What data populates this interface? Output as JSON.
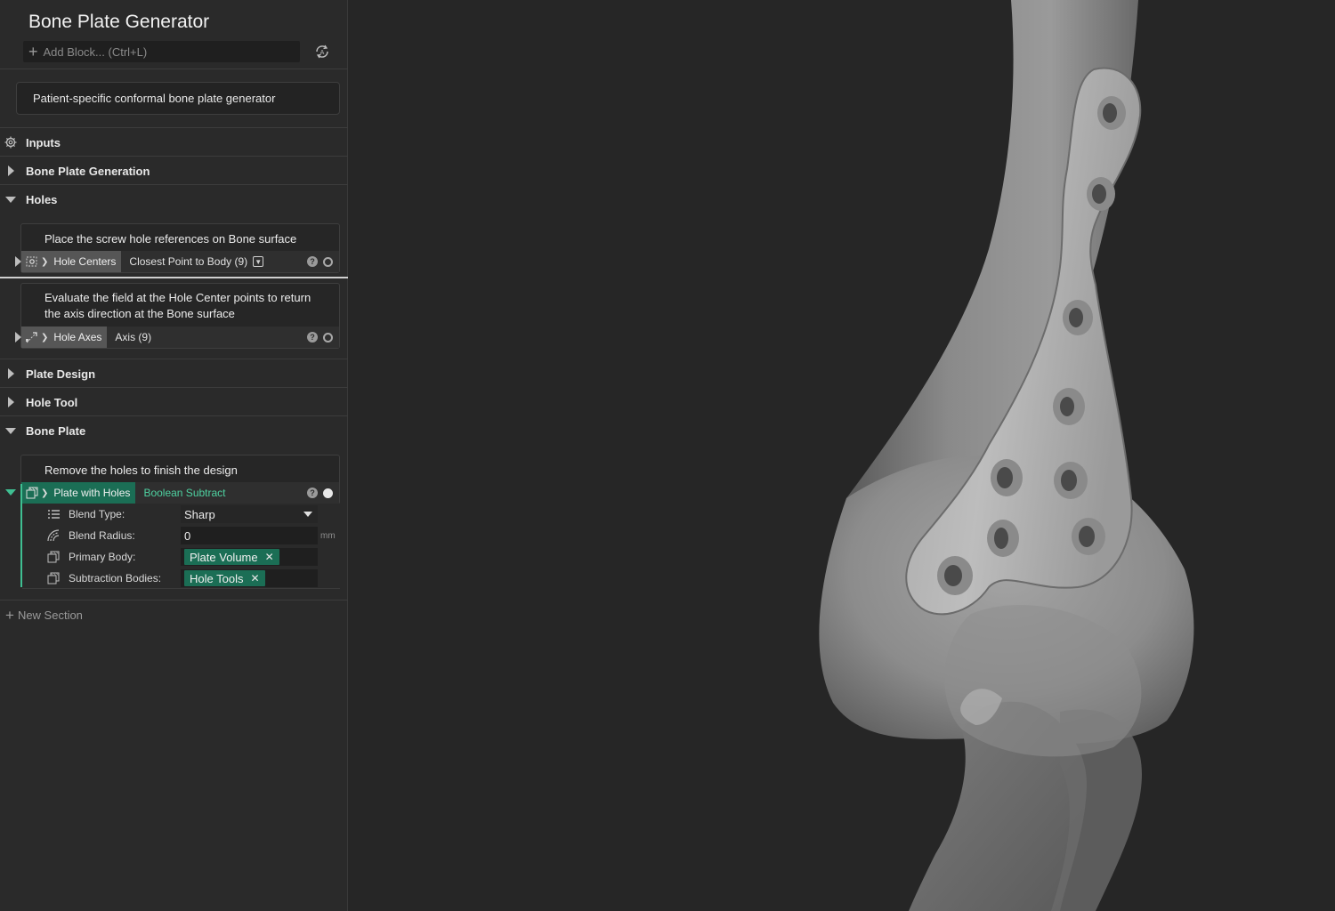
{
  "app": {
    "title": "Bone Plate Generator",
    "add_block_placeholder": "Add Block... (Ctrl+L)",
    "description": "Patient-specific conformal bone plate generator"
  },
  "sections": {
    "inputs": "Inputs",
    "bone_plate_generation": "Bone Plate Generation",
    "holes": "Holes",
    "plate_design": "Plate Design",
    "hole_tool": "Hole Tool",
    "bone_plate": "Bone Plate"
  },
  "blocks": {
    "hole_centers": {
      "description": "Place the screw hole references on Bone surface",
      "name": "Hole Centers",
      "operation": "Closest Point to Body (9)"
    },
    "hole_axes": {
      "description_line1": "Evaluate the field at the Hole Center points to return",
      "description_line2": "the axis direction at the Bone surface",
      "name": "Hole Axes",
      "operation": "Axis (9)"
    },
    "plate_with_holes": {
      "description": "Remove the holes to finish the design",
      "name": "Plate with Holes",
      "operation": "Boolean Subtract",
      "params": {
        "blend_type_label": "Blend Type:",
        "blend_type_value": "Sharp",
        "blend_radius_label": "Blend Radius:",
        "blend_radius_value": "0",
        "blend_radius_unit": "mm",
        "primary_body_label": "Primary Body:",
        "primary_body_value": "Plate Volume",
        "subtraction_bodies_label": "Subtraction Bodies:",
        "subtraction_bodies_value": "Hole Tools"
      }
    }
  },
  "footer": {
    "new_section": "New Section"
  },
  "colors": {
    "accent_green": "#1b6e55",
    "accent_text_green": "#4ed1a0",
    "panel_bg": "#2a2a2a",
    "viewport_bg": "#262626"
  }
}
